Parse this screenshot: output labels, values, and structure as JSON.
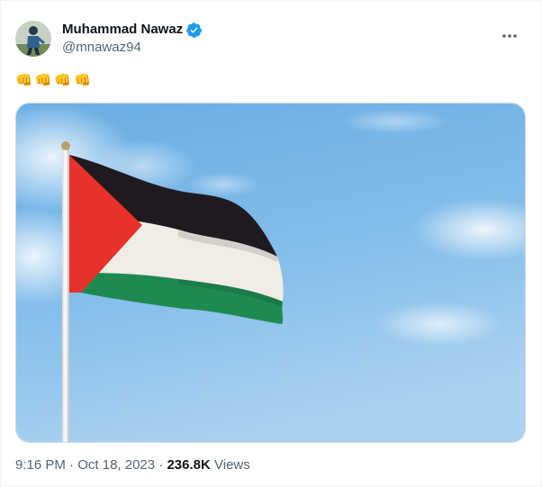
{
  "author": {
    "name": "Muhammad Nawaz",
    "handle": "@mnawaz94",
    "verified": true
  },
  "tweet": {
    "text_emojis": [
      "👊",
      "👊",
      "👊",
      "👊"
    ],
    "media_description_icon": "palestine-flag-image"
  },
  "meta": {
    "time": "9:16 PM",
    "separator": "·",
    "date": "Oct 18, 2023",
    "views_count": "236.8K",
    "views_label": "Views"
  },
  "colors": {
    "verified_blue": "#1d9bf0",
    "secondary_text": "#536471",
    "primary_text": "#0f1419",
    "sky": "#79b8e8",
    "flag_red": "#e8312a",
    "flag_black": "#1f1a1f",
    "flag_white": "#f2ece6",
    "flag_green": "#1e8a52"
  }
}
